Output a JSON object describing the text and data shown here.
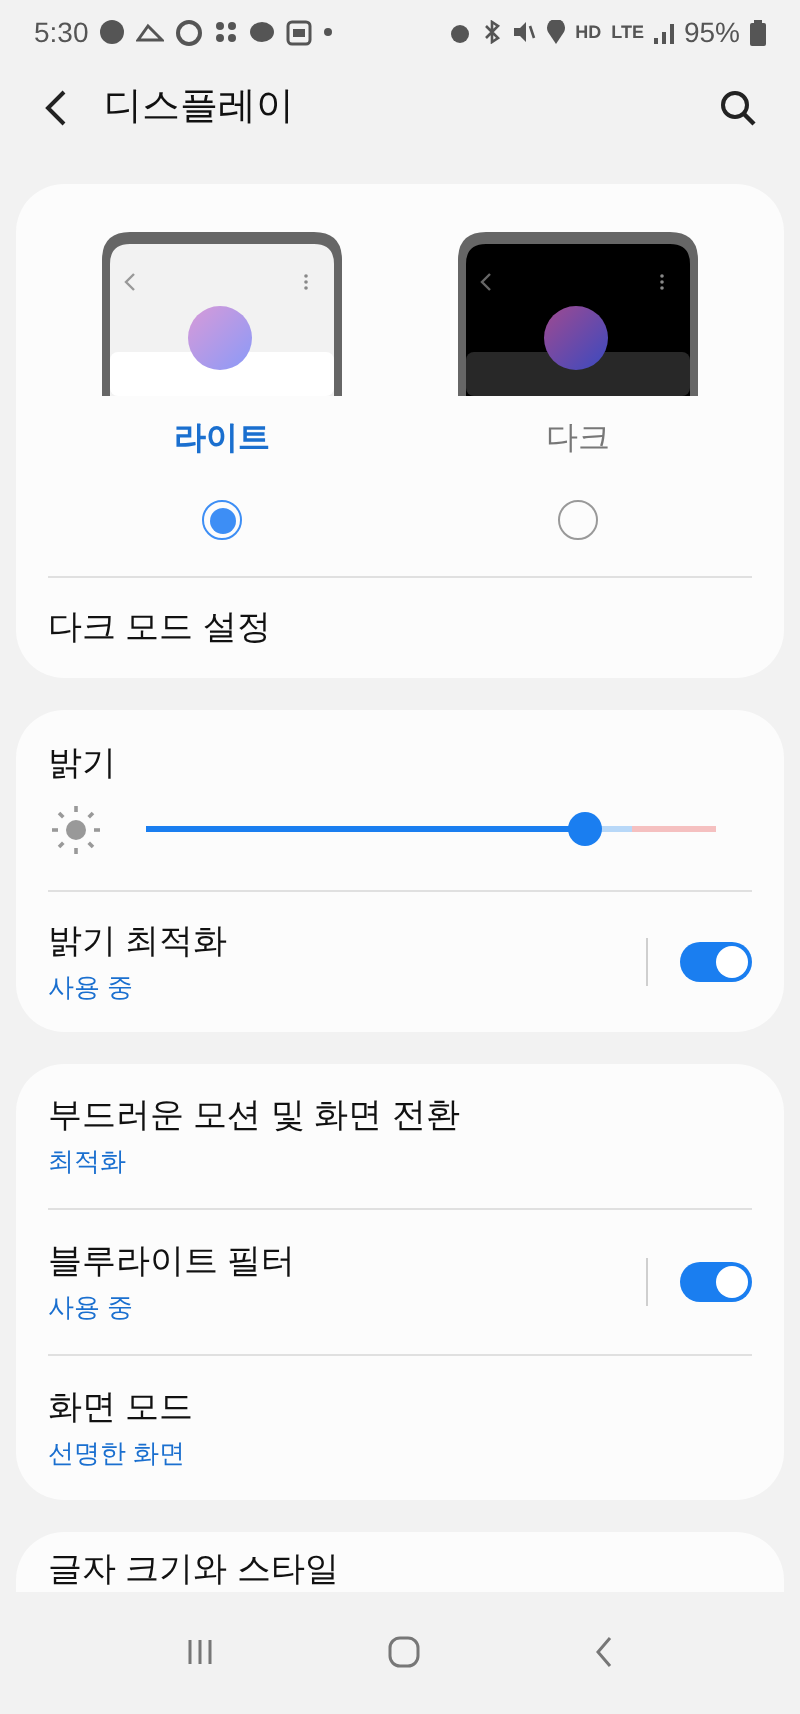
{
  "status_bar": {
    "time": "5:30",
    "network_labels": [
      "HD",
      "LTE"
    ],
    "battery": "95%"
  },
  "header": {
    "title": "디스플레이"
  },
  "theme_card": {
    "options": [
      {
        "kind": "light",
        "label": "라이트",
        "selected": true
      },
      {
        "kind": "dark",
        "label": "다크",
        "selected": false
      }
    ],
    "dark_mode_settings": "다크 모드 설정"
  },
  "brightness_card": {
    "title": "밝기",
    "slider": {
      "level": 0.77
    },
    "adaptive": {
      "title": "밝기 최적화",
      "subtitle": "사용 중",
      "on": true
    }
  },
  "settings_card": {
    "items": [
      {
        "title": "부드러운 모션 및 화면 전환",
        "subtitle": "최적화"
      },
      {
        "title": "블루라이트 필터",
        "subtitle": "사용 중",
        "on": true
      },
      {
        "title": "화면 모드",
        "subtitle": "선명한 화면"
      }
    ]
  },
  "font_card": {
    "title": "글자 크기와 스타일"
  }
}
